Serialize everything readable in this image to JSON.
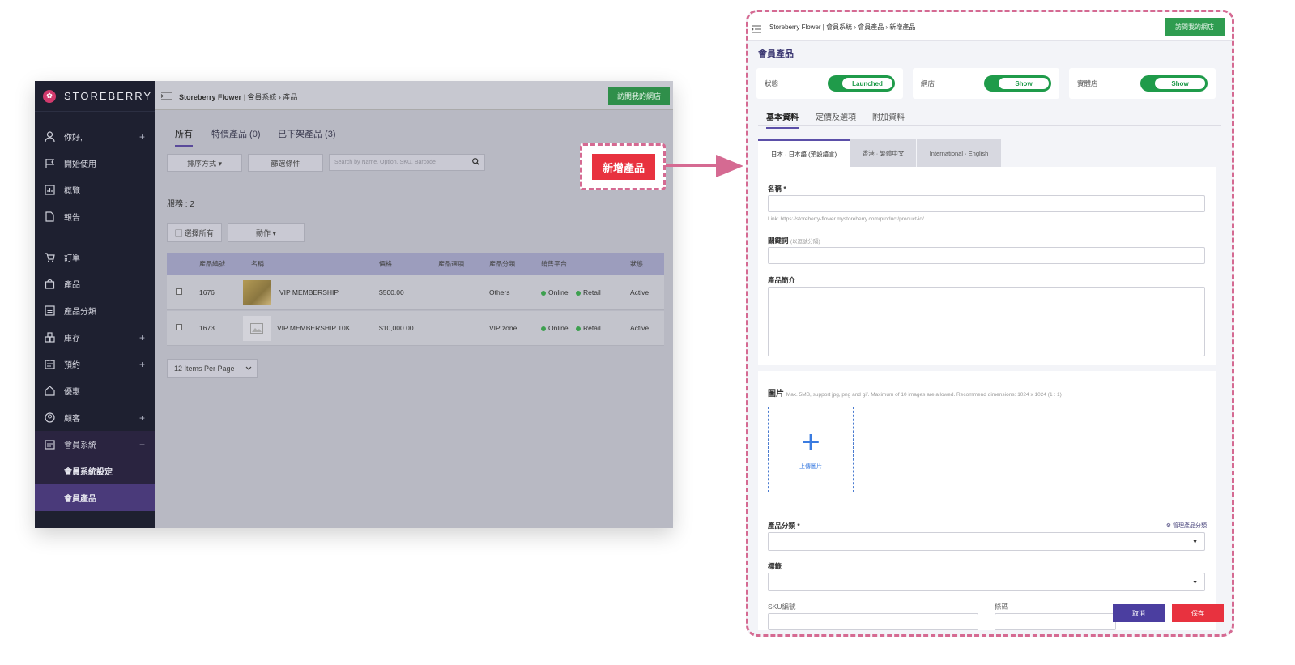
{
  "left": {
    "brand": "STOREBERRY",
    "sidebar": {
      "items": [
        {
          "label": "你好,",
          "icon": "user-icon",
          "plus": "+"
        },
        {
          "label": "開始使用",
          "icon": "flag-icon",
          "plus": ""
        },
        {
          "label": "概覽",
          "icon": "chart-icon",
          "plus": ""
        },
        {
          "label": "報告",
          "icon": "document-icon",
          "plus": ""
        },
        {
          "label": "訂單",
          "icon": "cart-icon",
          "plus": ""
        },
        {
          "label": "產品",
          "icon": "bag-icon",
          "plus": ""
        },
        {
          "label": "產品分類",
          "icon": "list-icon",
          "plus": ""
        },
        {
          "label": "庫存",
          "icon": "boxes-icon",
          "plus": "+"
        },
        {
          "label": "預約",
          "icon": "calendar-icon",
          "plus": "+"
        },
        {
          "label": "優惠",
          "icon": "home-tag-icon",
          "plus": ""
        },
        {
          "label": "顧客",
          "icon": "customer-icon",
          "plus": "+"
        },
        {
          "label": "會員系統",
          "icon": "membership-icon",
          "plus": "−"
        }
      ],
      "sub_items": [
        "會員系統設定",
        "會員產品"
      ]
    },
    "breadcrumb": {
      "store": "Storeberry Flower",
      "sep": "|",
      "path": "會員系統 › 產品"
    },
    "visit_store": "訪問我的網店",
    "tabs": [
      "所有",
      "特價產品 (0)",
      "已下架產品 (3)"
    ],
    "sort_btn": "排序方式 ▾",
    "filter_btn": "篩選條件",
    "search_placeholder": "Search by Name, Option, SKU, Barcode",
    "count_label": "服務 : 2",
    "select_all": "▢ 選擇所有",
    "actions_btn": "動作 ▾",
    "table": {
      "headers": [
        "產品編號",
        "名稱",
        "價格",
        "產品選項",
        "產品分類",
        "銷售平台",
        "狀態"
      ],
      "rows": [
        {
          "id": "1676",
          "name": "VIP MEMBERSHIP",
          "price": "$500.00",
          "option": "",
          "category": "Others",
          "online": "Online",
          "retail": "Retail",
          "status": "Active"
        },
        {
          "id": "1673",
          "name": "VIP MEMBERSHIP 10K",
          "price": "$10,000.00",
          "option": "",
          "category": "VIP zone",
          "online": "Online",
          "retail": "Retail",
          "status": "Active"
        }
      ]
    },
    "per_page": "12 Items Per Page"
  },
  "add_product": "新增產品",
  "right": {
    "breadcrumb": "Storeberry Flower  |  會員系統 › 會員產品 › 新增產品",
    "visit_store": "訪問我的網店",
    "title": "會員產品",
    "status_cards": [
      {
        "label": "狀態",
        "value": "Launched"
      },
      {
        "label": "網店",
        "value": "Show"
      },
      {
        "label": "實體店",
        "value": "Show"
      }
    ],
    "tabs": [
      "基本資料",
      "定價及選項",
      "附加資料"
    ],
    "lang_tabs": [
      "日本 · 日本語 (預設語言)",
      "香港 · 繁體中文",
      "International · English"
    ],
    "fields": {
      "name_label": "名稱 *",
      "link_hint": "Link: https://storeberry-flower.mystoreberry.com/product/product-id/",
      "keyword_label": "關鍵詞",
      "keyword_hint": "(以逗號分隔)",
      "desc_label": "產品簡介",
      "image_label": "圖片",
      "image_hint": "Max. 5MB, support jpg, png and gif. Maximum of 10 images are allowed. Recommend dimensions: 1024 x 1024 (1 : 1)",
      "upload_label": "上傳圖片",
      "category_label": "產品分類 *",
      "manage_category": "⚙ 管理產品分類",
      "tag_label": "標籤",
      "sku_label": "SKU編號",
      "barcode_label": "條碼"
    },
    "cancel": "取消",
    "save": "保存"
  },
  "colors": {
    "accent": "#e8323f",
    "brand_purple": "#4b3ea0",
    "toggle_green": "#1f9b4a",
    "highlight": "#d56a92"
  }
}
